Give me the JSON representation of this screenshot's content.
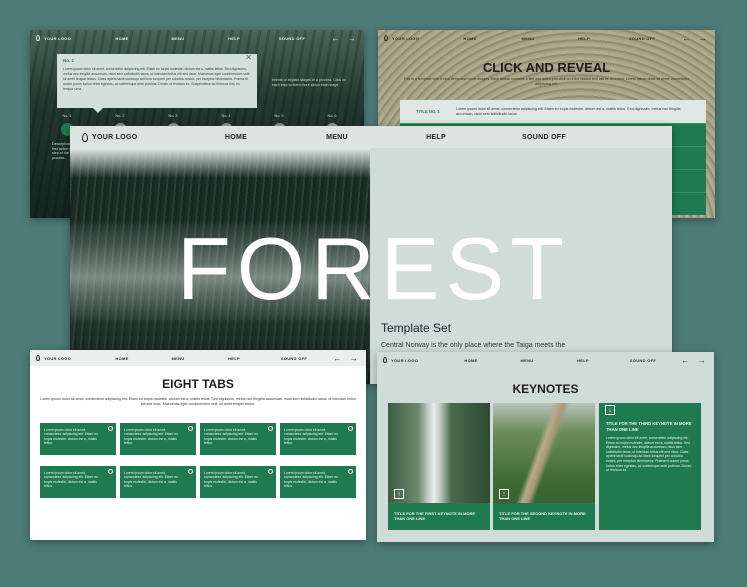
{
  "colors": {
    "background": "#4d7b77",
    "accent": "#1f7a50",
    "panel": "#d0dcd7"
  },
  "nav": {
    "logo": "YOUR LOGO",
    "home": "HOME",
    "menu": "MENU",
    "help": "HELP",
    "sound": "SOUND OFF",
    "prev_icon": "arrow-left-icon",
    "next_icon": "arrow-right-icon"
  },
  "hero": {
    "title": "FOREST",
    "subtitle": "Template Set",
    "text": "Central Norway is the only place where the Taiga meets the"
  },
  "timeline": {
    "popup_title": "No. 1",
    "popup_text": "Lorem ipsum dolor sit amet, consectetur adipiscing elit. Etiam eu turpis molestie, dictum est a, mattis tellus. Sed dignissim, metus nec fringilla accumsan, risus sem sollicitudin lacus, ut interdum tellus elit sed risus. Maecenas eget condimentum velit, sit amet feugiat lectus. Class aptent taciti sociosqu ad litora torquent per conubia nostra, per inceptos himenaeos. Praesent auctor purus luctus enim egestas, ac scelerisque ante pulvinar. Donec ut rhoncus ex. Suspendisse ac rhoncus nisl, eu tempor urna.",
    "side_text": "events or explain stages of a process. Click on each step to learn more about each stage.",
    "steps": [
      "No. 1",
      "No. 2",
      "No. 3",
      "No. 4",
      "No. 5",
      "No. 6"
    ],
    "step_desc": "Description of the first action or step of the process."
  },
  "reveal": {
    "title": "CLICK AND REVEAL",
    "lead": "This is a template with 5 click items and hover images. Each button contains a title and when you click on it the hidden text will be revealed. Lorem ipsum dolor sit amet, consectetur adipiscing elit.",
    "first_label": "TITLE NO. 1",
    "first_text": "Lorem ipsum dolor sit amet, consectetur adipiscing elit. Etiam eu turpis molestie, dictum est a, mattis tellus. Sed dignissim, metus nec fringilla accumsan, risus sem sollicitudin lacus."
  },
  "tabs": {
    "title": "EIGHT TABS",
    "lead": "Lorem ipsum dolor sit amet, consectetur adipiscing elit. Etiam eu turpis molestie, dictum est a, mattis tellus. Sed dignissim, metus nec fringilla accumsan, risus sem sollicitudin lacus, ut interdum tellus elit sed risus. Maecenas eget condimentum velit, sit amet feugiat lectus.",
    "tab_text": "Lorem ipsum dolor sit amet, consectetur adipiscing elit. Etiam eu turpis molestie, dictum est a, mattis tellus."
  },
  "keynotes": {
    "title": "KEYNOTES",
    "k1": "TITLE FOR THE FIRST KEYNOTE IN MORE THAN ONE LINE",
    "k2": "TITLE FOR THE SECOND KEYNOTE IN MORE THAN ONE LINE",
    "k3": "TITLE FOR THE THIRD KEYNOTE IN MORE THAN ONE LINE",
    "k3_text": "Lorem ipsum dolor sit amet, consectetur adipiscing elit. Etiam eu turpis molestie, dictum est a, mattis tellus. Sed dignissim, metus nec fringilla accumsan, risus sem sollicitudin lacus, ut interdum tellus elit sed risus. Class aptent taciti sociosqu ad litora torquent per conubia nostra, per inceptos himenaeos. Praesent auctor purus luctus enim egestas, ac scelerisque ante pulvinar. Donec ut rhoncus ex."
  }
}
